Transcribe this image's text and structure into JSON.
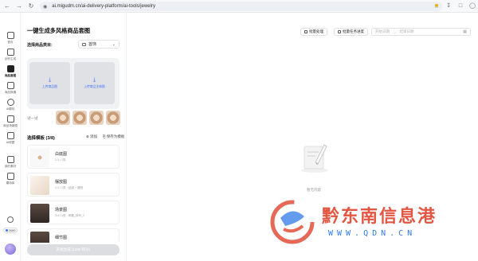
{
  "browser": {
    "url": "ai.migudm.cn/ai-delivery-platform/ai-tools/jewelry"
  },
  "rail": {
    "items": [
      {
        "label": "首页"
      },
      {
        "label": "创作生成"
      },
      {
        "label": "商品套图"
      },
      {
        "label": "商品换模"
      },
      {
        "label": "AI模特"
      },
      {
        "label": "商品场景图"
      },
      {
        "label": "AI修图"
      },
      {
        "label": "我的素材"
      },
      {
        "label": "模特库"
      }
    ],
    "coin_count": "2000"
  },
  "panel": {
    "title": "一键生成多风格商品套图",
    "category_label": "选择商品类目:",
    "category_value": "首饰",
    "upload_main": "上传商品图",
    "upload_detail": "上传商品主体图",
    "try_label": "试一试",
    "templates_header": "选择模板 (3/8)",
    "add_label": "添加",
    "save_label": "保存为模板",
    "templates": [
      {
        "name": "白底图",
        "sub": "1:1 / 1张"
      },
      {
        "name": "摆放图",
        "sub": "1:1 / 1张 · 丝绒 + 摆拍"
      },
      {
        "name": "场景图",
        "sub": "3:4 / 1张 · 佩戴_特写_2"
      },
      {
        "name": "细节图",
        "sub": ""
      }
    ],
    "generate_label": "开始生成 (1200 积分)"
  },
  "main": {
    "batch_label": "批量处理",
    "tasks_label": "批量任务进度",
    "start_date_placeholder": "开始日期",
    "end_date_placeholder": "结束日期",
    "empty_text": "暂无内容"
  },
  "watermark": {
    "title": "黔东南信息港",
    "url": "WWW.QDN.CN"
  },
  "colors": {
    "accent": "#3f6bff",
    "button_disabled": "#dcdde0",
    "watermark_red": "#e0442e",
    "watermark_blue": "#2f7be6"
  }
}
